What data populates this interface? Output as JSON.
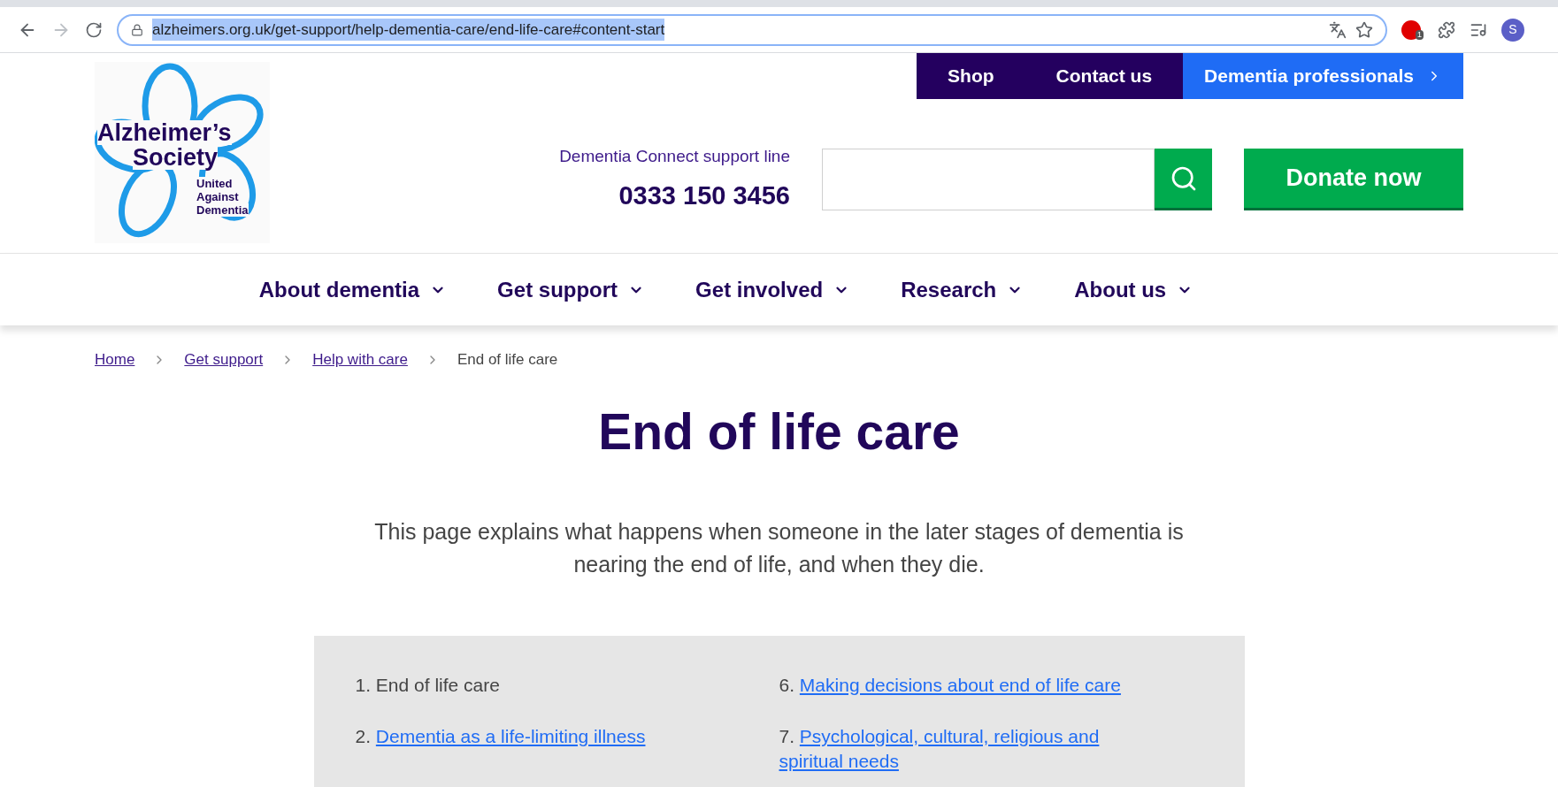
{
  "browser": {
    "url": "alzheimers.org.uk/get-support/help-dementia-care/end-life-care#content-start",
    "profile_initial": "S",
    "adblock_count": "1"
  },
  "logo": {
    "name_lines": [
      "Alzheimer’s",
      "Society"
    ],
    "tagline_lines": [
      "United",
      "Against",
      "Dementia"
    ]
  },
  "top_links": [
    {
      "label": "Shop",
      "kind": "plain"
    },
    {
      "label": "Contact us",
      "kind": "plain"
    },
    {
      "label": "Dementia professionals",
      "kind": "highlight"
    }
  ],
  "support_line": {
    "label": "Dementia Connect support line",
    "phone": "0333 150 3456"
  },
  "donate_button": "Donate now",
  "nav": [
    "About dementia",
    "Get support",
    "Get involved",
    "Research",
    "About us"
  ],
  "breadcrumbs": [
    {
      "label": "Home",
      "current": false
    },
    {
      "label": "Get support",
      "current": false
    },
    {
      "label": "Help with care",
      "current": false
    },
    {
      "label": "End of life care",
      "current": true
    }
  ],
  "title": "End of life care",
  "intro": "This page explains what happens when someone in the later stages of dementia is nearing the end of life, and when they die.",
  "contents": {
    "columns": [
      [
        {
          "number": "1.",
          "label": "End of life care",
          "current": true
        },
        {
          "number": "2.",
          "label": "Dementia as a life-limiting illness",
          "current": false
        }
      ],
      [
        {
          "number": "6.",
          "label": "Making decisions about end of life care",
          "current": false
        },
        {
          "number": "7.",
          "label": "Psychological, cultural, religious and spiritual needs",
          "current": false
        }
      ]
    ]
  }
}
